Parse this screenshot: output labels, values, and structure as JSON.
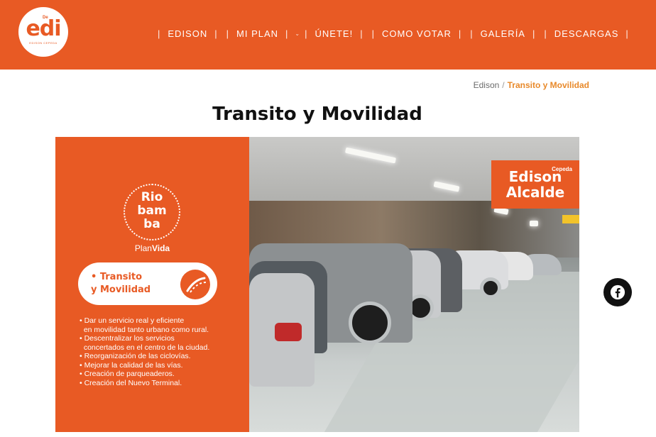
{
  "header": {
    "logo": {
      "small": "De",
      "main": "edi",
      "sub": "EDISON CEPEDA"
    },
    "nav": [
      {
        "label": "EDISON",
        "has_caret": false
      },
      {
        "label": "MI PLAN",
        "has_caret": true
      },
      {
        "label": "ÚNETE!",
        "has_caret": false
      },
      {
        "label": "COMO VOTAR",
        "has_caret": false
      },
      {
        "label": "GALERÍA",
        "has_caret": false
      },
      {
        "label": "DESCARGAS",
        "has_caret": false
      }
    ],
    "background_color": "#e85a24"
  },
  "breadcrumb": {
    "home": "Edison",
    "separator": "/",
    "current": "Transito y Movilidad"
  },
  "page_title": "Transito y Movilidad",
  "banner": {
    "riobamba": "Rio\nbam\nba",
    "plan_prefix": "Plan",
    "plan_bold": "Vida",
    "pill_label_line1": "• Transito",
    "pill_label_line2": "y Movilidad",
    "bullets": [
      "• Dar un servicio real y eficiente",
      "  en movilidad tanto urbano como rural.",
      "• Descentralizar los servicios",
      "  concertados en el centro de la ciudad.",
      "• Reorganización de las ciclovías.",
      "• Mejorar la calidad de las vías.",
      "• Creación de parqueaderos.",
      "• Creación del Nuevo Terminal."
    ],
    "brand_small": "Cepeda",
    "brand_name_line1": "Edison",
    "brand_name_line2": "Alcalde",
    "accent_color": "#e85a24"
  },
  "social": {
    "icon": "facebook-icon"
  }
}
